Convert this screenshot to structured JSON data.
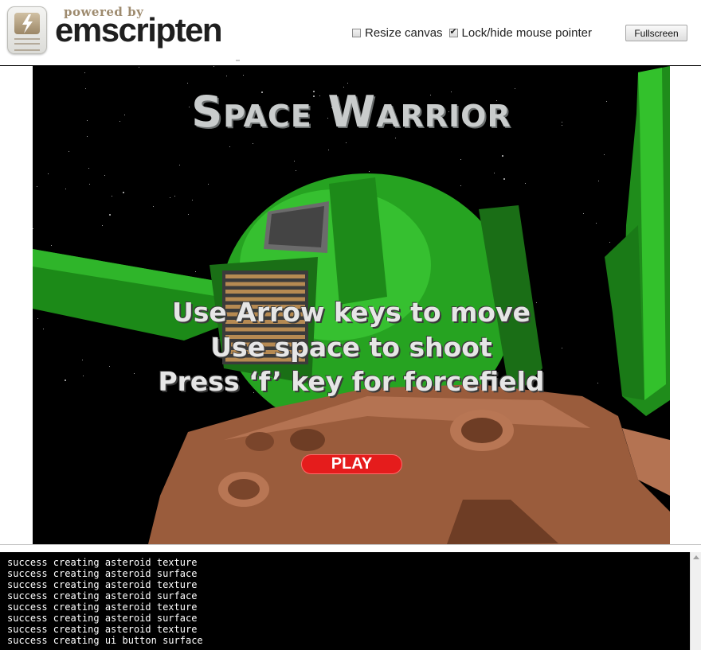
{
  "header": {
    "powered_by": "powered by",
    "brand": "emscripten",
    "resize_label": "Resize canvas",
    "resize_checked": false,
    "lock_label": "Lock/hide mouse pointer",
    "lock_checked": true,
    "fullscreen_label": "Fullscreen"
  },
  "game": {
    "title": "Space Warrior",
    "instructions": [
      "Use Arrow keys to move",
      "Use space to shoot",
      "Press ‘f’ key for forcefield"
    ],
    "play_label": "PLAY",
    "colors": {
      "space": "#000000",
      "ship_green": "#22a81e",
      "asteroid": "#9a5c3c",
      "play_red": "#e51c1c"
    }
  },
  "console": {
    "lines": [
      "success creating asteroid texture",
      "success creating asteroid surface",
      "success creating asteroid texture",
      "success creating asteroid surface",
      "success creating asteroid texture",
      "success creating asteroid surface",
      "success creating asteroid texture",
      "success creating ui button surface"
    ]
  }
}
